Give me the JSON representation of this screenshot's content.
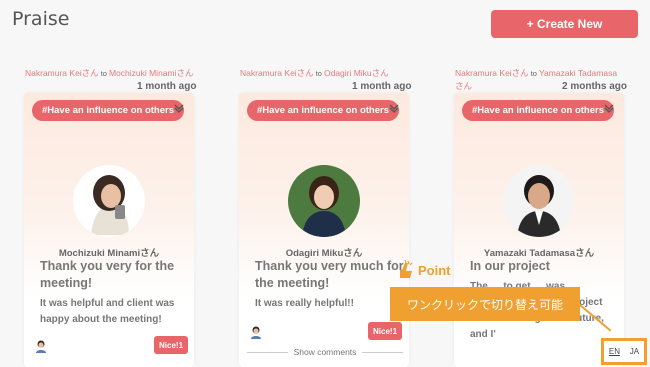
{
  "page": {
    "title": "Praise",
    "create_label": "+ Create New"
  },
  "cards": [
    {
      "sender": "Nakramura Keiさん",
      "to": "to",
      "receiver": "Mochizuki Minamiさん",
      "ago": "1 month ago",
      "tag": "#Have an influence on others",
      "recv_name": "Mochizuki Minamiさん",
      "title": "Thank you very for the meeting!",
      "body": "It was helpful and client was happy about the meeting!",
      "nice": "Nice!1"
    },
    {
      "sender": "Nakramura Keiさん",
      "to": "to",
      "receiver": "Odagiri Mikuさん",
      "ago": "1 month ago",
      "tag": "#Have an influence on others",
      "recv_name": "Odagiri Mikuさん",
      "title": "Thank you very much for the meeting!",
      "body": "It was really helpful!!",
      "nice": "Nice!1",
      "comments": "Show comments"
    },
    {
      "sender": "Nakramura Keiさん",
      "to": "to",
      "receiver": "Yamazaki Tadamasaさん",
      "ago": "2 months ago",
      "tag": "#Have an influence on others",
      "recv_name": "Yamazaki Tadamasaさん",
      "title": "In our project",
      "body": "The … to get … was impressive! Another project will be running in the future, and I'"
    }
  ],
  "annotation": {
    "point_label": "Point",
    "callout": "ワンクリックで切り替え可能",
    "lang_en": "EN",
    "lang_ja": "JA"
  },
  "colors": {
    "accent": "#e8656a",
    "callout": "#f0a030"
  }
}
